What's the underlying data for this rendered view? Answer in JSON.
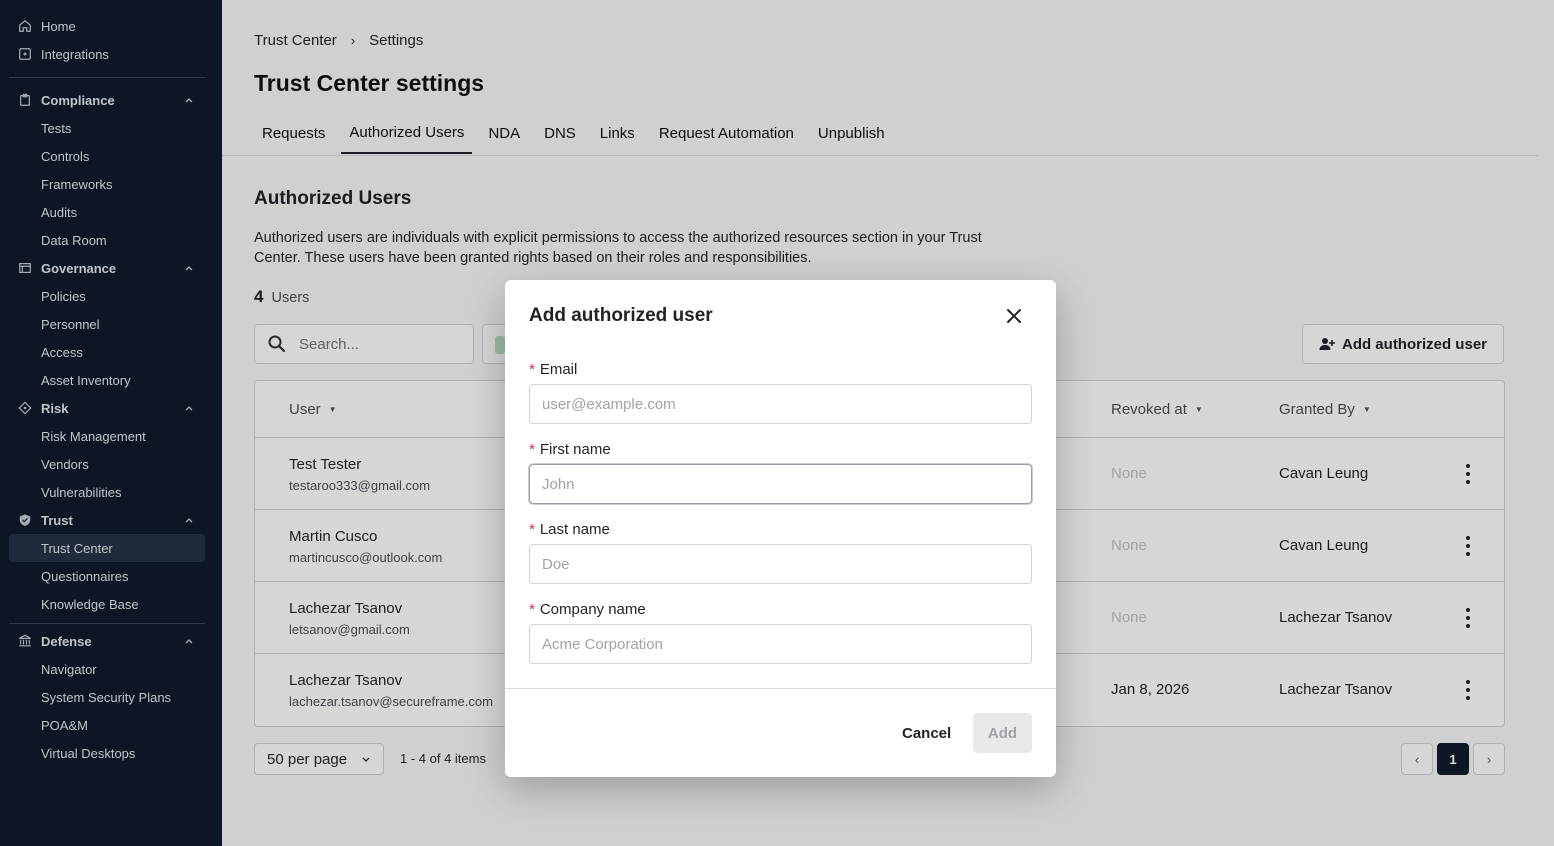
{
  "sidebar": {
    "top_items": [
      {
        "label": "Home",
        "icon": "home-icon"
      },
      {
        "label": "Integrations",
        "icon": "integrations-icon"
      }
    ],
    "groups": [
      {
        "label": "Compliance",
        "icon": "clipboard-icon",
        "items": [
          "Tests",
          "Controls",
          "Frameworks",
          "Audits",
          "Data Room"
        ]
      },
      {
        "label": "Governance",
        "icon": "governance-icon",
        "items": [
          "Policies",
          "Personnel",
          "Access",
          "Asset Inventory"
        ]
      },
      {
        "label": "Risk",
        "icon": "diamond-icon",
        "items": [
          "Risk Management",
          "Vendors",
          "Vulnerabilities"
        ]
      },
      {
        "label": "Trust",
        "icon": "shield-icon",
        "items": [
          "Trust Center",
          "Questionnaires",
          "Knowledge Base"
        ],
        "active_item": "Trust Center"
      },
      {
        "label": "Defense",
        "icon": "bank-icon",
        "items": [
          "Navigator",
          "System Security Plans",
          "POA&M",
          "Virtual Desktops"
        ]
      }
    ]
  },
  "breadcrumb": {
    "parent": "Trust Center",
    "current": "Settings"
  },
  "page_title": "Trust Center settings",
  "tabs": [
    {
      "label": "Requests",
      "active": false
    },
    {
      "label": "Authorized Users",
      "active": true
    },
    {
      "label": "NDA",
      "active": false
    },
    {
      "label": "DNS",
      "active": false
    },
    {
      "label": "Links",
      "active": false
    },
    {
      "label": "Request Automation",
      "active": false
    },
    {
      "label": "Unpublish",
      "active": false
    }
  ],
  "section": {
    "title": "Authorized Users",
    "description": "Authorized users are individuals with explicit permissions to access the authorized resources section in your Trust Center. These users have been granted rights based on their roles and responsibilities.",
    "count": "4",
    "count_label": "Users"
  },
  "search": {
    "placeholder": "Search..."
  },
  "add_button_label": "Add authorized user",
  "table": {
    "columns": {
      "user": "User",
      "revoked_at": "Revoked at",
      "granted_by": "Granted By"
    },
    "rows": [
      {
        "name": "Test Tester",
        "email": "testaroo333@gmail.com",
        "revoked_at": "None",
        "granted_by": "Cavan Leung"
      },
      {
        "name": "Martin Cusco",
        "email": "martincusco@outlook.com",
        "revoked_at": "None",
        "granted_by": "Cavan Leung"
      },
      {
        "name": "Lachezar Tsanov",
        "email": "letsanov@gmail.com",
        "revoked_at": "None",
        "granted_by": "Lachezar Tsanov"
      },
      {
        "name": "Lachezar Tsanov",
        "email": "lachezar.tsanov@secureframe.com",
        "revoked_at": "Jan 8, 2026",
        "granted_by": "Lachezar Tsanov"
      }
    ]
  },
  "pagination": {
    "per_page": "50 per page",
    "range": "1 - 4 of 4 items",
    "current_page": "1"
  },
  "modal": {
    "title": "Add authorized user",
    "fields": [
      {
        "label": "Email",
        "placeholder": "user@example.com"
      },
      {
        "label": "First name",
        "placeholder": "John"
      },
      {
        "label": "Last name",
        "placeholder": "Doe"
      },
      {
        "label": "Company name",
        "placeholder": "Acme Corporation"
      }
    ],
    "cancel_label": "Cancel",
    "add_label": "Add"
  }
}
